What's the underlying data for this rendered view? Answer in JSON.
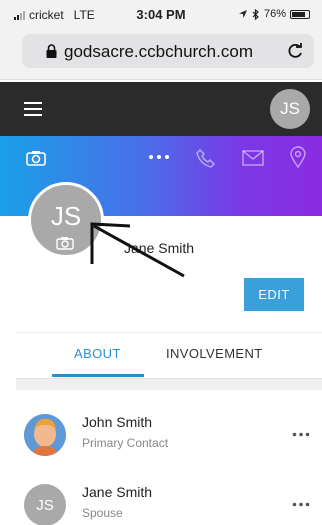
{
  "status_bar": {
    "carrier": "cricket",
    "network": "LTE",
    "time": "3:04 PM",
    "battery": "76%"
  },
  "browser": {
    "url": "godsacre.ccbchurch.com"
  },
  "header": {
    "avatar_initials": "JS"
  },
  "profile": {
    "avatar_initials": "JS",
    "name": "Jane Smith",
    "edit_label": "EDIT"
  },
  "tabs": [
    {
      "label": "ABOUT",
      "active": true
    },
    {
      "label": "INVOLVEMENT",
      "active": false
    }
  ],
  "contacts": [
    {
      "name": "John Smith",
      "role": "Primary Contact",
      "initials": ""
    },
    {
      "name": "Jane Smith",
      "role": "Spouse",
      "initials": "JS"
    }
  ],
  "colors": {
    "accent": "#3aa0db",
    "header_bg": "#2b2b2b",
    "gradient_start": "#1aa0e8",
    "gradient_end": "#8a2be2",
    "avatar_gray": "#a9a9a9"
  },
  "icons": [
    "signal-icon",
    "location-arrow-icon",
    "bluetooth-icon",
    "battery-icon",
    "lock-icon",
    "reload-icon",
    "hamburger-icon",
    "camera-icon",
    "more-icon",
    "phone-icon",
    "mail-icon",
    "map-pin-icon",
    "arrow-annotation"
  ]
}
